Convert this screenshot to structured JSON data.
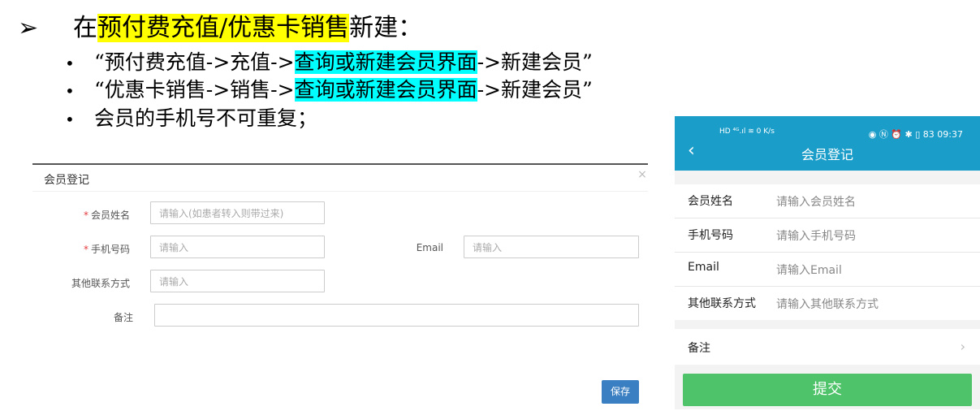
{
  "slide": {
    "arrow_glyph": "➢",
    "heading_prefix": "在",
    "heading_highlight": "预付费充值/优惠卡销售",
    "heading_suffix": "新建：",
    "bullet_glyph": "•",
    "bullets": [
      {
        "pre": "“预付费充值->充值->",
        "highlight": "查询或新建会员界面",
        "post": "->新建会员”"
      },
      {
        "pre": "“优惠卡销售->销售->",
        "highlight": "查询或新建会员界面",
        "post": "->新建会员”"
      },
      {
        "pre": "会员的手机号不可重复；",
        "highlight": "",
        "post": ""
      }
    ],
    "colors": {
      "yellow_highlight": "#ffff00",
      "cyan_highlight": "#00ffff"
    }
  },
  "dialog": {
    "title": "会员登记",
    "close_glyph": "×",
    "required_mark": "*",
    "fields": {
      "name_label": "会员姓名",
      "name_placeholder": "请输入(如患者转入则带过来)",
      "phone_label": "手机号码",
      "phone_placeholder": "请输入",
      "email_label": "Email",
      "email_placeholder": "请输入",
      "other_label": "其他联系方式",
      "other_placeholder": "请输入",
      "remark_label": "备注",
      "remark_value": ""
    },
    "save_label": "保存",
    "colors": {
      "save_button": "#3a7fc2",
      "required": "#e4393c"
    }
  },
  "phone": {
    "status_left": "HD ⁴ᴳ.ıl ≋ 0 K/s",
    "status_right": "◉ Ⓝ ⏰ ✱ ▯ 83 09:37",
    "back_glyph": "‹",
    "title": "会员登记",
    "rows": [
      {
        "label": "会员姓名",
        "placeholder": "请输入会员姓名"
      },
      {
        "label": "手机号码",
        "placeholder": "请输入手机号码"
      },
      {
        "label": "Email",
        "placeholder": "请输入Email"
      },
      {
        "label": "其他联系方式",
        "placeholder": "请输入其他联系方式"
      }
    ],
    "remark_label": "备注",
    "chevron_glyph": "›",
    "submit_label": "提交",
    "colors": {
      "header": "#1a9dc9",
      "submit": "#4fc36a"
    }
  }
}
